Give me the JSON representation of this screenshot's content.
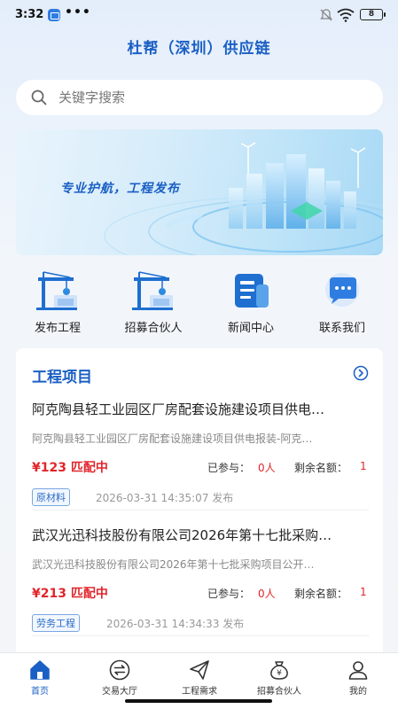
{
  "status_bar": {
    "time": "3:32",
    "dots": "•••",
    "battery": "8"
  },
  "app_title": "杜帮（深圳）供应链",
  "search": {
    "placeholder": "关键字搜索"
  },
  "banner": {
    "slogan": "专业护航，工程发布"
  },
  "quick_actions": [
    {
      "label": "发布工程",
      "icon": "crane-icon"
    },
    {
      "label": "招募合伙人",
      "icon": "crane-recruit-icon"
    },
    {
      "label": "新闻中心",
      "icon": "news-icon"
    },
    {
      "label": "联系我们",
      "icon": "chat-bubble-icon"
    }
  ],
  "projects_section": {
    "title": "工程项目",
    "items": [
      {
        "title": "阿克陶县轻工业园区厂房配套设施建设项目供电…",
        "desc": "阿克陶县轻工业园区厂房配套设施建设项目供电报装-阿克…",
        "price": "¥123 匹配中",
        "joined_label": "已参与：",
        "joined_value": "0人",
        "remaining_label": "剩余名额：",
        "remaining_value": "1",
        "tag": "原材料",
        "time": "2026-03-31 14:35:07 发布"
      },
      {
        "title": "武汉光迅科技股份有限公司2026年第十七批采购…",
        "desc": "武汉光迅科技股份有限公司2026年第十七批采购项目公开…",
        "price": "¥213 匹配中",
        "joined_label": "已参与：",
        "joined_value": "0人",
        "remaining_label": "剩余名额：",
        "remaining_value": "1",
        "tag": "劳务工程",
        "time": "2026-03-31 14:34:33 发布"
      }
    ]
  },
  "tabbar": [
    {
      "label": "首页",
      "icon": "home-icon",
      "active": true
    },
    {
      "label": "交易大厅",
      "icon": "exchange-icon",
      "active": false
    },
    {
      "label": "工程需求",
      "icon": "paper-plane-icon",
      "active": false
    },
    {
      "label": "招募合伙人",
      "icon": "money-bag-icon",
      "active": false
    },
    {
      "label": "我的",
      "icon": "user-icon",
      "active": false
    }
  ],
  "colors": {
    "brand": "#1a5fc4",
    "price": "#e0262c"
  }
}
